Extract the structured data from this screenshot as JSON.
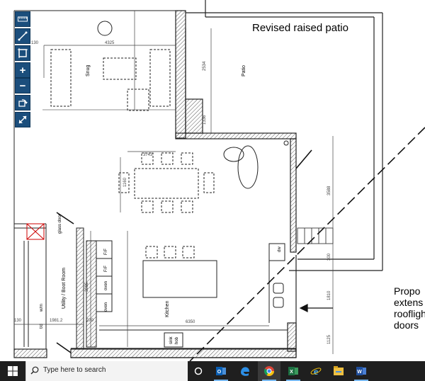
{
  "plan": {
    "title_patio": "Revised raised patio",
    "room_snug": "Snug",
    "room_patio": "Patio",
    "room_utility": "Utility / Boot Room",
    "room_kitchen": "Kitchen",
    "label_glass_door": "glass door",
    "label_ff1": "F/F",
    "label_ff2": "F/F",
    "label_oven1": "oven",
    "label_oven2": "oven",
    "label_wm": "w/m",
    "label_td": "t/d",
    "label_dw": "dw",
    "label_sink": "sink",
    "label_hob": "hob",
    "dim_4325": "4325",
    "dim_130": "130",
    "dim_2534": "2534",
    "dim_1336": "1336",
    "dim_3743": "3743",
    "dim_1160": "1160",
    "dim_3588": "3588",
    "dim_300": "300",
    "dim_3985": "3985",
    "dim_1810": "1810",
    "dim_1125": "1125",
    "dim_6350": "6350",
    "dim_1981": "1981.2",
    "dim_270": "270",
    "dim_130b": "130",
    "note_line1": "Propo",
    "note_line2": "extens",
    "note_line3": "roofligh",
    "note_line4": "doors"
  },
  "toolbar": {
    "items": [
      "ruler-icon",
      "line-icon",
      "frame-icon",
      "zoom-in-icon",
      "zoom-out-icon",
      "rotate-icon",
      "expand-icon"
    ],
    "zoom_in_label": "+",
    "zoom_out_label": "−"
  },
  "taskbar": {
    "search_placeholder": "Type here to search",
    "apps": [
      "task-view-icon",
      "outlook-icon",
      "edge-icon",
      "chrome-icon",
      "excel-icon",
      "ie-icon",
      "file-explorer-icon",
      "word-icon"
    ],
    "colors": {
      "bar": "#1f1f1f",
      "accent": "#78b8f0"
    }
  }
}
